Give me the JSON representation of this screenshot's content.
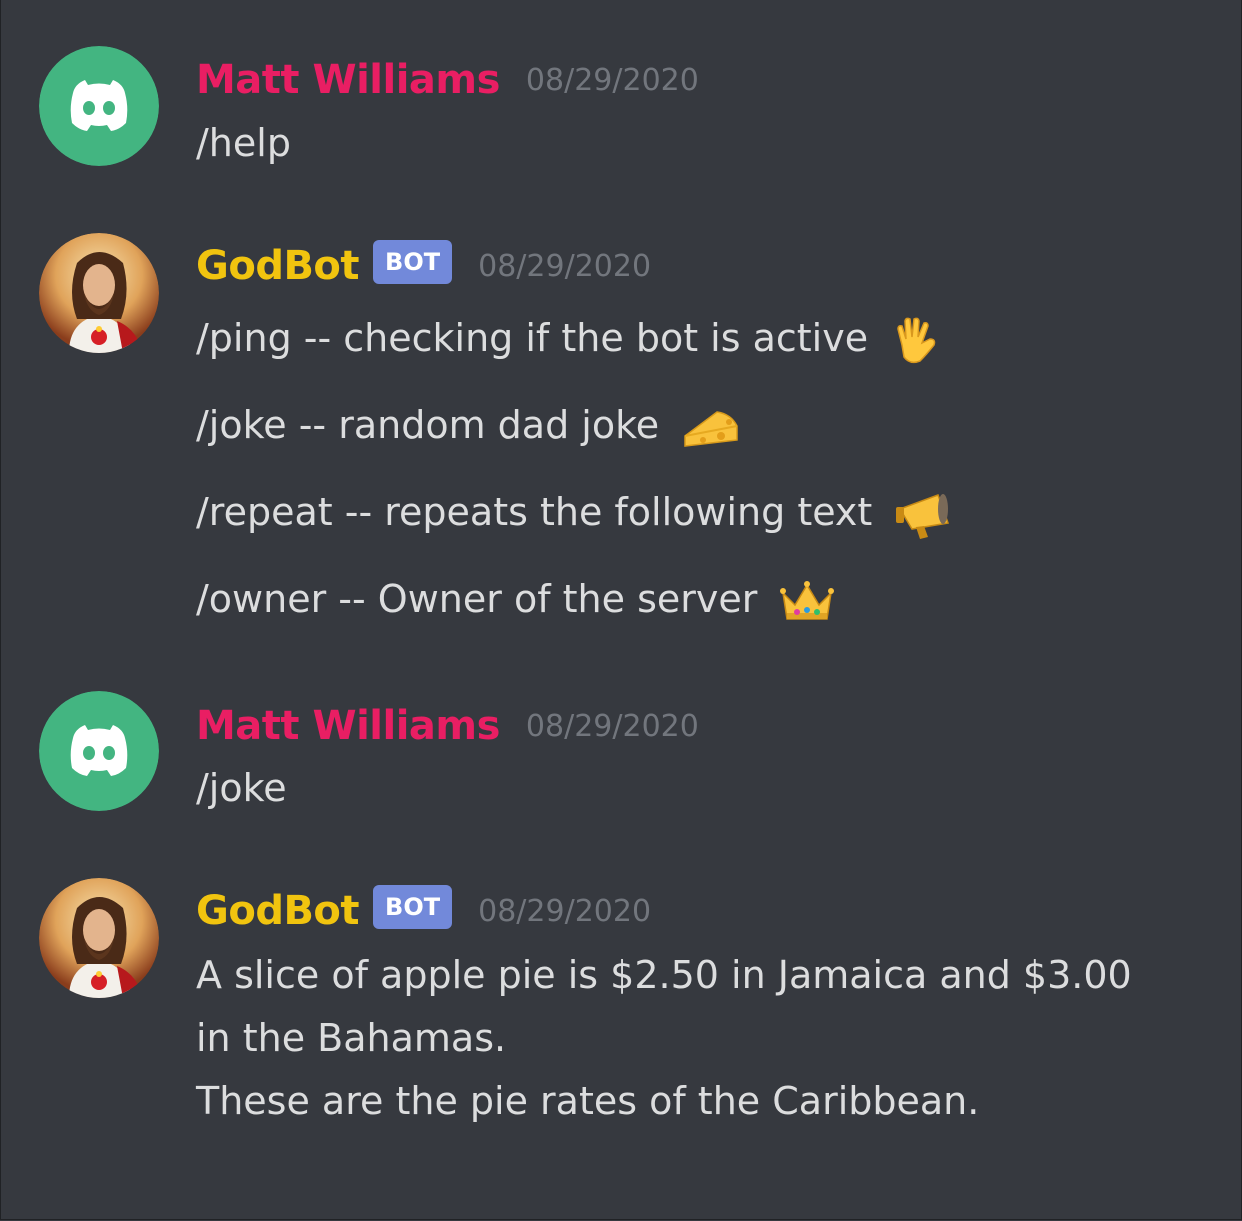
{
  "messages": [
    {
      "author": "Matt Williams",
      "author_color": "#e91e63",
      "avatar": "discord-logo-icon",
      "timestamp": "08/29/2020",
      "text": "/help"
    },
    {
      "author": "GodBot",
      "author_color": "#f1c40f",
      "avatar": "godbot-avatar",
      "badge": "BOT",
      "timestamp": "08/29/2020",
      "lines": [
        {
          "text": "/ping -- checking if the bot is active",
          "emoji": "vulcan-salute-icon"
        },
        {
          "text": "/joke -- random dad joke",
          "emoji": "cheese-icon"
        },
        {
          "text": "/repeat -- repeats the following text",
          "emoji": "megaphone-icon"
        },
        {
          "text": "/owner -- Owner of the server",
          "emoji": "crown-icon"
        }
      ]
    },
    {
      "author": "Matt Williams",
      "author_color": "#e91e63",
      "avatar": "discord-logo-icon",
      "timestamp": "08/29/2020",
      "text": "/joke"
    },
    {
      "author": "GodBot",
      "author_color": "#f1c40f",
      "avatar": "godbot-avatar",
      "badge": "BOT",
      "timestamp": "08/29/2020",
      "lines": [
        {
          "text": "A slice of apple pie is $2.50 in Jamaica and $3.00"
        },
        {
          "text": "in the Bahamas."
        },
        {
          "text": "These are the pie rates of the Caribbean."
        }
      ]
    }
  ],
  "colors": {
    "background": "#36393f",
    "text": "#dcddde",
    "timestamp": "#72767d",
    "badge": "#7289da",
    "discord_avatar_bg": "#43b581"
  }
}
